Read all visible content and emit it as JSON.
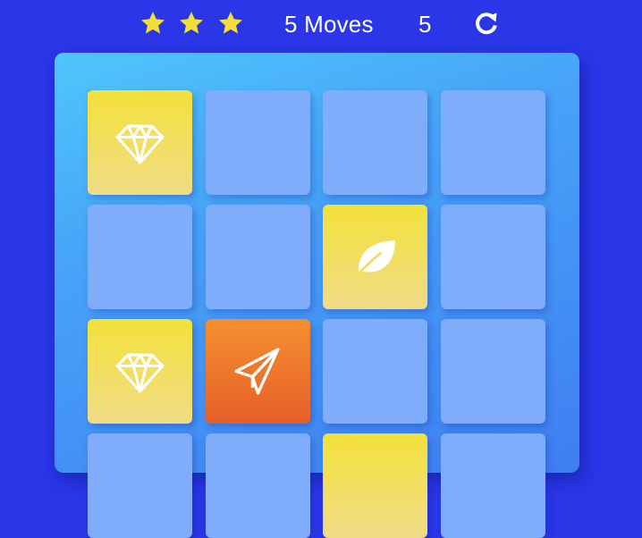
{
  "hud": {
    "stars": [
      {
        "name": "star-1-icon",
        "filled": true
      },
      {
        "name": "star-2-icon",
        "filled": true
      },
      {
        "name": "star-3-icon",
        "filled": true
      }
    ],
    "moves_label": "5 Moves",
    "timer": "5",
    "restart_icon": "restart-icon"
  },
  "deck": {
    "rows": [
      [
        {
          "state": "match",
          "icon": "diamond-icon"
        },
        {
          "state": "hidden",
          "icon": ""
        },
        {
          "state": "hidden",
          "icon": ""
        },
        {
          "state": "hidden",
          "icon": ""
        }
      ],
      [
        {
          "state": "hidden",
          "icon": ""
        },
        {
          "state": "hidden",
          "icon": ""
        },
        {
          "state": "match",
          "icon": "leaf-icon"
        },
        {
          "state": "hidden",
          "icon": ""
        }
      ],
      [
        {
          "state": "match",
          "icon": "diamond-icon"
        },
        {
          "state": "open",
          "icon": "paper-plane-icon"
        },
        {
          "state": "hidden",
          "icon": ""
        },
        {
          "state": "hidden",
          "icon": ""
        }
      ],
      [
        {
          "state": "hidden",
          "icon": ""
        },
        {
          "state": "hidden",
          "icon": ""
        },
        {
          "state": "match",
          "icon": ""
        },
        {
          "state": "hidden",
          "icon": ""
        }
      ]
    ]
  },
  "colors": {
    "background": "#2a36e8",
    "star": "#f2de34",
    "card_hidden": "#7fadfc",
    "card_match": "#f3e13b",
    "card_open": "#f07a2c"
  }
}
